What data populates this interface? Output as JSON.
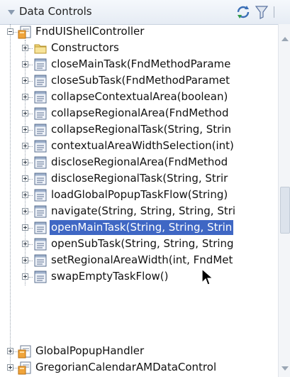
{
  "header": {
    "title": "Data Controls",
    "icons": {
      "refresh": "refresh-icon",
      "filter": "filter-icon",
      "collapse": "collapse-triangle-icon"
    }
  },
  "tree": {
    "root": {
      "label": "FndUIShellController",
      "expanded": true,
      "icon": "data-control-icon"
    },
    "children": [
      {
        "label": "Constructors",
        "icon": "folder-icon"
      },
      {
        "label": "closeMainTask(FndMethodParame",
        "icon": "method-icon"
      },
      {
        "label": "closeSubTask(FndMethodParamet",
        "icon": "method-icon"
      },
      {
        "label": "collapseContextualArea(boolean)",
        "icon": "method-icon"
      },
      {
        "label": "collapseRegionalArea(FndMethod",
        "icon": "method-icon"
      },
      {
        "label": "collapseRegionalTask(String, Strin",
        "icon": "method-icon"
      },
      {
        "label": "contextualAreaWidthSelection(int)",
        "icon": "method-icon"
      },
      {
        "label": "discloseRegionalArea(FndMethod",
        "icon": "method-icon"
      },
      {
        "label": "discloseRegionalTask(String, Strir",
        "icon": "method-icon"
      },
      {
        "label": "loadGlobalPopupTaskFlow(String)",
        "icon": "method-icon"
      },
      {
        "label": "navigate(String, String, String, Stri",
        "icon": "method-icon"
      },
      {
        "label": "openMainTask(String, String, Strin",
        "icon": "method-icon",
        "selected": true
      },
      {
        "label": "openSubTask(String, String, String",
        "icon": "method-icon"
      },
      {
        "label": "setRegionalAreaWidth(int, FndMet",
        "icon": "method-icon"
      },
      {
        "label": "swapEmptyTaskFlow()",
        "icon": "method-icon"
      }
    ],
    "siblings": [
      {
        "label": "GlobalPopupHandler",
        "icon": "data-control-icon"
      },
      {
        "label": "GregorianCalendarAMDataControl",
        "icon": "data-control-icon"
      }
    ]
  },
  "colors": {
    "selection": "#3f67c4",
    "header_bg": "#e9eef5",
    "tree_lines": "#9aa4b0"
  }
}
